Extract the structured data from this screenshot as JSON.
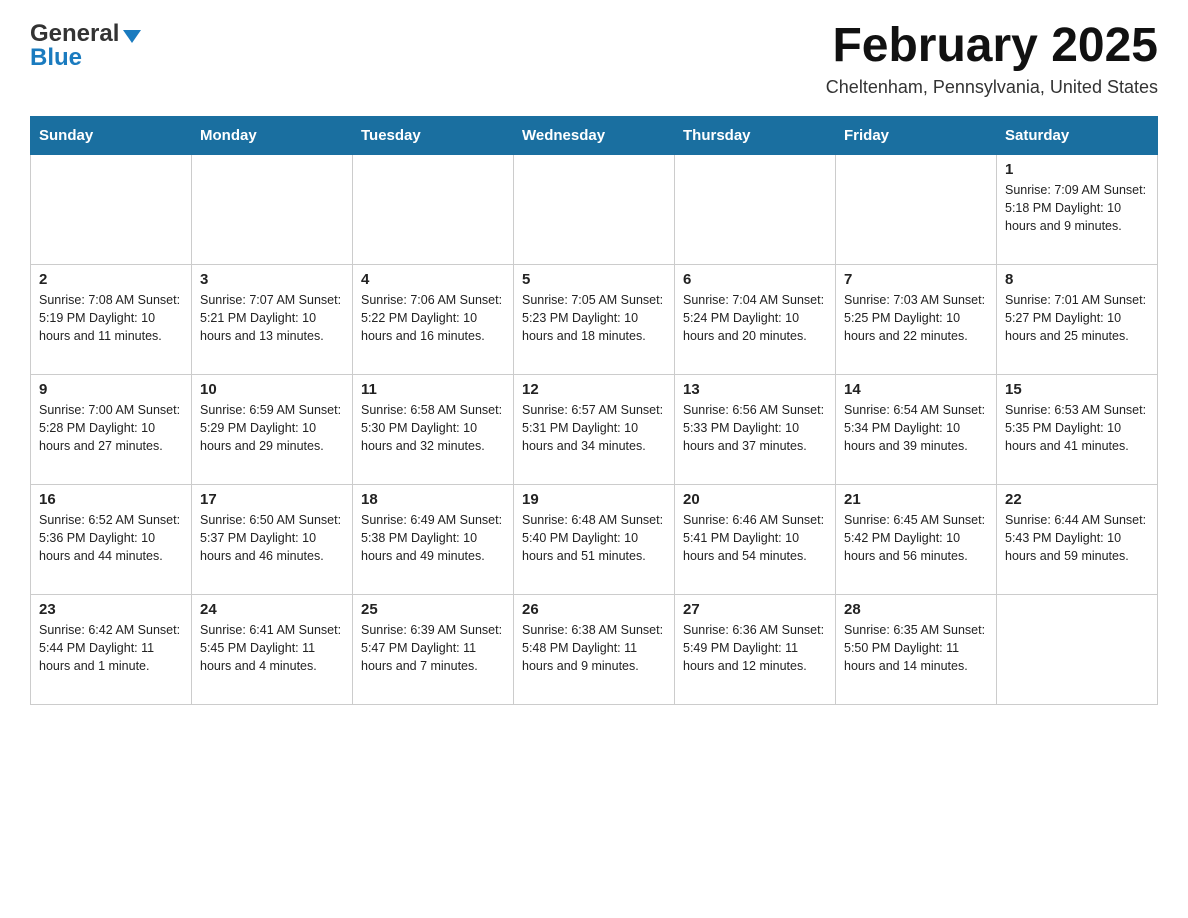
{
  "header": {
    "logo_general": "General",
    "logo_blue": "Blue",
    "month_title": "February 2025",
    "location": "Cheltenham, Pennsylvania, United States"
  },
  "days_of_week": [
    "Sunday",
    "Monday",
    "Tuesday",
    "Wednesday",
    "Thursday",
    "Friday",
    "Saturday"
  ],
  "weeks": [
    [
      {
        "day": "",
        "info": ""
      },
      {
        "day": "",
        "info": ""
      },
      {
        "day": "",
        "info": ""
      },
      {
        "day": "",
        "info": ""
      },
      {
        "day": "",
        "info": ""
      },
      {
        "day": "",
        "info": ""
      },
      {
        "day": "1",
        "info": "Sunrise: 7:09 AM\nSunset: 5:18 PM\nDaylight: 10 hours and 9 minutes."
      }
    ],
    [
      {
        "day": "2",
        "info": "Sunrise: 7:08 AM\nSunset: 5:19 PM\nDaylight: 10 hours and 11 minutes."
      },
      {
        "day": "3",
        "info": "Sunrise: 7:07 AM\nSunset: 5:21 PM\nDaylight: 10 hours and 13 minutes."
      },
      {
        "day": "4",
        "info": "Sunrise: 7:06 AM\nSunset: 5:22 PM\nDaylight: 10 hours and 16 minutes."
      },
      {
        "day": "5",
        "info": "Sunrise: 7:05 AM\nSunset: 5:23 PM\nDaylight: 10 hours and 18 minutes."
      },
      {
        "day": "6",
        "info": "Sunrise: 7:04 AM\nSunset: 5:24 PM\nDaylight: 10 hours and 20 minutes."
      },
      {
        "day": "7",
        "info": "Sunrise: 7:03 AM\nSunset: 5:25 PM\nDaylight: 10 hours and 22 minutes."
      },
      {
        "day": "8",
        "info": "Sunrise: 7:01 AM\nSunset: 5:27 PM\nDaylight: 10 hours and 25 minutes."
      }
    ],
    [
      {
        "day": "9",
        "info": "Sunrise: 7:00 AM\nSunset: 5:28 PM\nDaylight: 10 hours and 27 minutes."
      },
      {
        "day": "10",
        "info": "Sunrise: 6:59 AM\nSunset: 5:29 PM\nDaylight: 10 hours and 29 minutes."
      },
      {
        "day": "11",
        "info": "Sunrise: 6:58 AM\nSunset: 5:30 PM\nDaylight: 10 hours and 32 minutes."
      },
      {
        "day": "12",
        "info": "Sunrise: 6:57 AM\nSunset: 5:31 PM\nDaylight: 10 hours and 34 minutes."
      },
      {
        "day": "13",
        "info": "Sunrise: 6:56 AM\nSunset: 5:33 PM\nDaylight: 10 hours and 37 minutes."
      },
      {
        "day": "14",
        "info": "Sunrise: 6:54 AM\nSunset: 5:34 PM\nDaylight: 10 hours and 39 minutes."
      },
      {
        "day": "15",
        "info": "Sunrise: 6:53 AM\nSunset: 5:35 PM\nDaylight: 10 hours and 41 minutes."
      }
    ],
    [
      {
        "day": "16",
        "info": "Sunrise: 6:52 AM\nSunset: 5:36 PM\nDaylight: 10 hours and 44 minutes."
      },
      {
        "day": "17",
        "info": "Sunrise: 6:50 AM\nSunset: 5:37 PM\nDaylight: 10 hours and 46 minutes."
      },
      {
        "day": "18",
        "info": "Sunrise: 6:49 AM\nSunset: 5:38 PM\nDaylight: 10 hours and 49 minutes."
      },
      {
        "day": "19",
        "info": "Sunrise: 6:48 AM\nSunset: 5:40 PM\nDaylight: 10 hours and 51 minutes."
      },
      {
        "day": "20",
        "info": "Sunrise: 6:46 AM\nSunset: 5:41 PM\nDaylight: 10 hours and 54 minutes."
      },
      {
        "day": "21",
        "info": "Sunrise: 6:45 AM\nSunset: 5:42 PM\nDaylight: 10 hours and 56 minutes."
      },
      {
        "day": "22",
        "info": "Sunrise: 6:44 AM\nSunset: 5:43 PM\nDaylight: 10 hours and 59 minutes."
      }
    ],
    [
      {
        "day": "23",
        "info": "Sunrise: 6:42 AM\nSunset: 5:44 PM\nDaylight: 11 hours and 1 minute."
      },
      {
        "day": "24",
        "info": "Sunrise: 6:41 AM\nSunset: 5:45 PM\nDaylight: 11 hours and 4 minutes."
      },
      {
        "day": "25",
        "info": "Sunrise: 6:39 AM\nSunset: 5:47 PM\nDaylight: 11 hours and 7 minutes."
      },
      {
        "day": "26",
        "info": "Sunrise: 6:38 AM\nSunset: 5:48 PM\nDaylight: 11 hours and 9 minutes."
      },
      {
        "day": "27",
        "info": "Sunrise: 6:36 AM\nSunset: 5:49 PM\nDaylight: 11 hours and 12 minutes."
      },
      {
        "day": "28",
        "info": "Sunrise: 6:35 AM\nSunset: 5:50 PM\nDaylight: 11 hours and 14 minutes."
      },
      {
        "day": "",
        "info": ""
      }
    ]
  ]
}
